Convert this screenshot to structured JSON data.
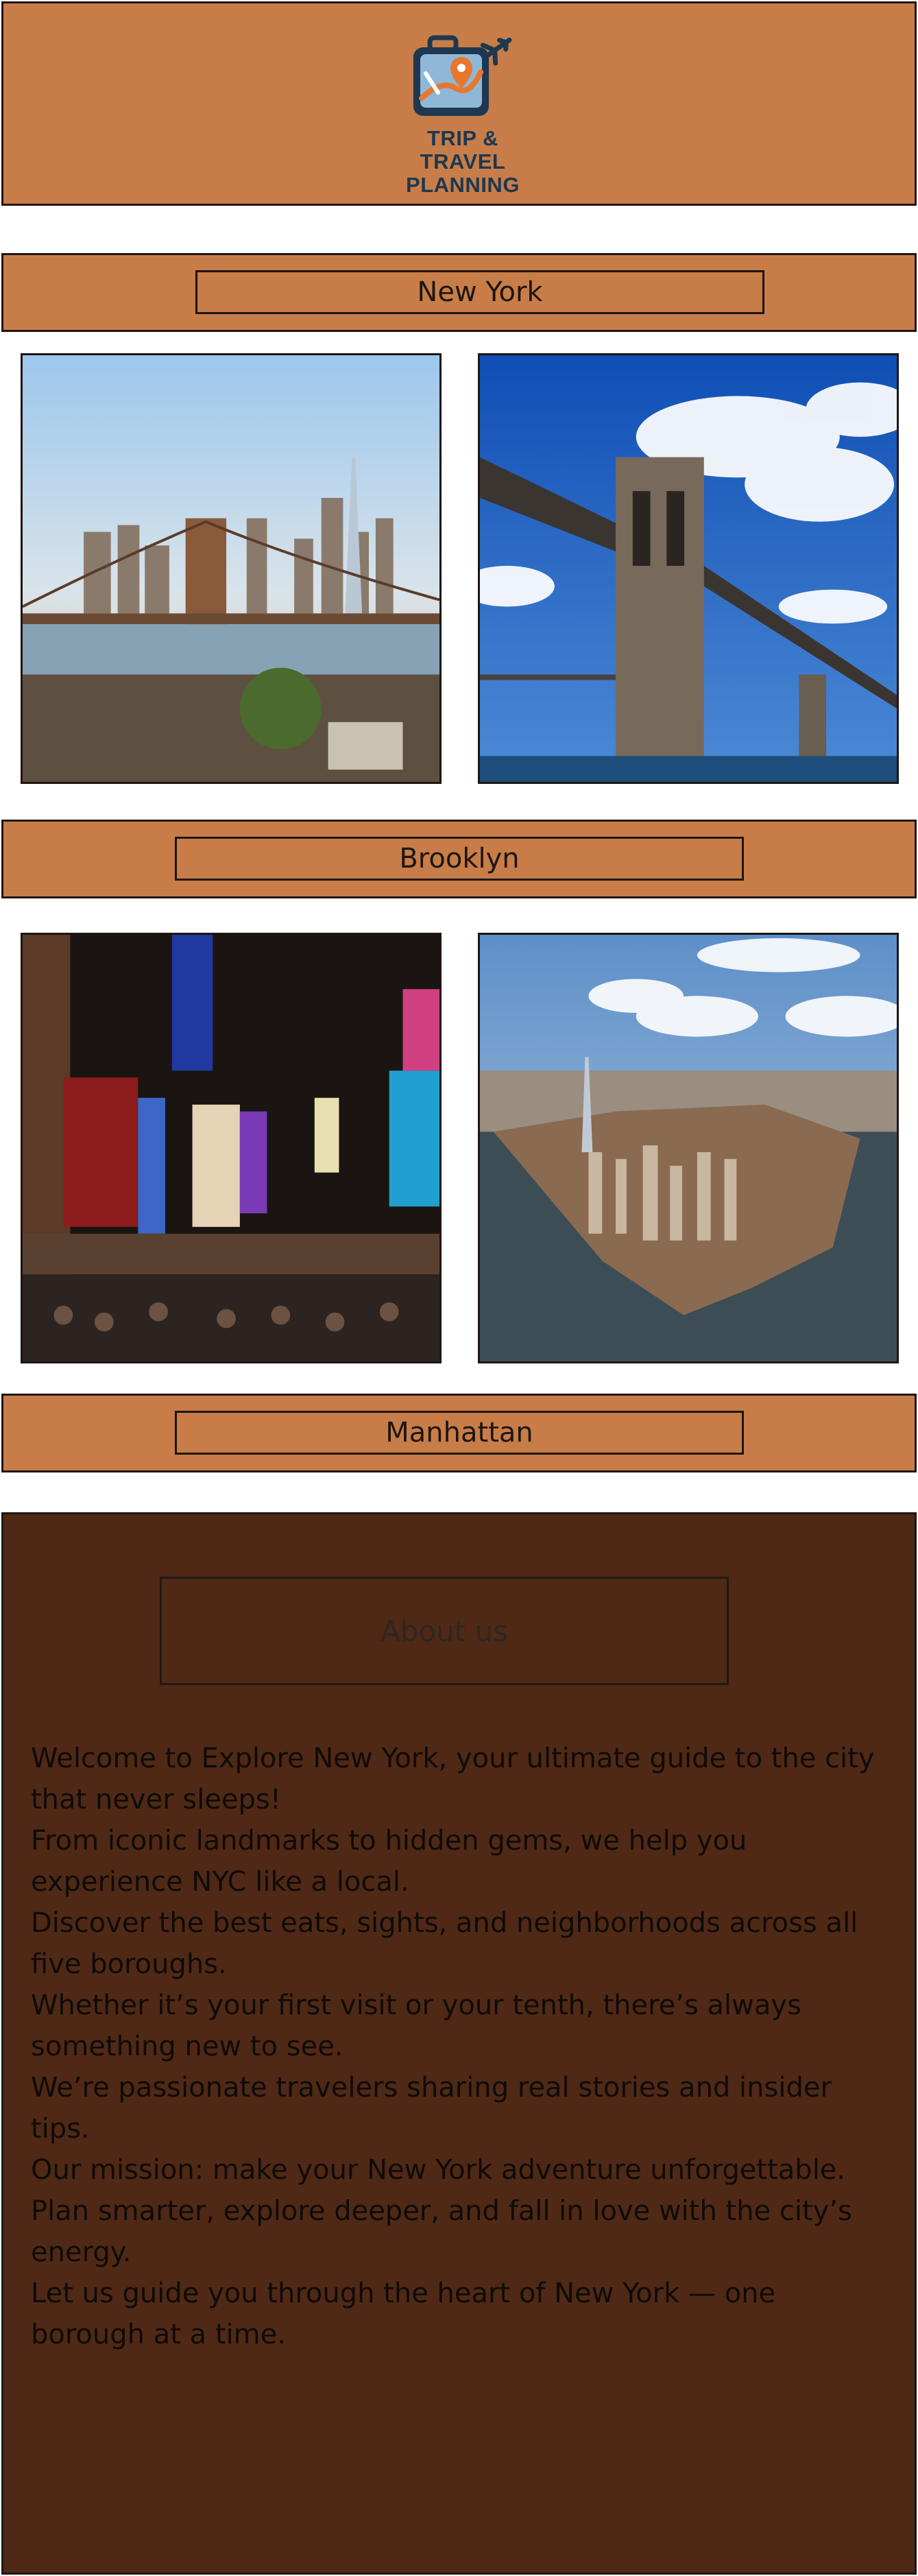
{
  "header": {
    "logo_icon": "suitcase-map-pin-airplane-icon",
    "logo_line1": "TRIP & TRAVEL",
    "logo_line2": "PLANNING"
  },
  "sections": [
    {
      "label": "New York"
    },
    {
      "label": "Brooklyn"
    },
    {
      "label": "Manhattan"
    }
  ],
  "photos": [
    {
      "name": "brooklyn-bridge-skyline-photo"
    },
    {
      "name": "brooklyn-bridge-tower-photo"
    },
    {
      "name": "times-square-photo"
    },
    {
      "name": "manhattan-aerial-photo"
    }
  ],
  "about": {
    "title": "About us",
    "paragraphs": [
      "Welcome to Explore New York, your ultimate guide to the city that never sleeps!",
      "From iconic landmarks to hidden gems, we help you experience NYC like a local.",
      "Discover the best eats, sights, and neighborhoods across all five boroughs.",
      "Whether it’s your first visit or your tenth, there’s always something new to see.",
      "We’re passionate travelers sharing real stories and insider tips.",
      "Our mission: make your New York adventure unforgettable.",
      "Plan smarter, explore deeper, and fall in love with the city’s energy.",
      "Let us guide you through the heart of New York — one borough at a time."
    ]
  },
  "colors": {
    "bar": "#c87d48",
    "about_bg": "#4f2916",
    "border": "#1e1612",
    "logo_navy": "#1d3850",
    "logo_orange": "#e8772e"
  }
}
